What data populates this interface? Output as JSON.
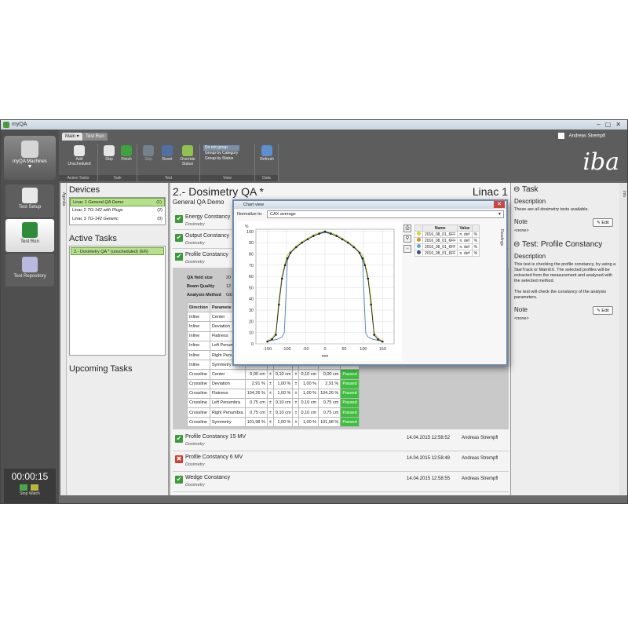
{
  "window": {
    "title": "myQA"
  },
  "user": {
    "name": "Andreas Strempfl"
  },
  "brand": {
    "logo_text": "iba"
  },
  "left_nav": {
    "machines_label": "myQA Machines",
    "items": [
      {
        "label": "Test Setup",
        "icon": "clipboard-icon",
        "active": false
      },
      {
        "label": "Test Run",
        "icon": "play-icon",
        "active": true
      },
      {
        "label": "Test Repository",
        "icon": "repository-icon",
        "active": false
      }
    ],
    "stopwatch": {
      "time": "00:00:15",
      "label": "Stop Watch"
    }
  },
  "ribbon": {
    "tabs": [
      "Main",
      "Test Run"
    ],
    "groups": [
      {
        "label": "Active Tasks",
        "buttons": [
          "Add Unscheduled"
        ]
      },
      {
        "label": "Task",
        "buttons": [
          "Skip",
          "Finish"
        ]
      },
      {
        "label": "Test",
        "buttons": [
          "Skip",
          "Reset",
          "Override Status"
        ]
      },
      {
        "label": "View",
        "options": [
          "Do not group",
          "Group by Category",
          "Group by Status"
        ]
      },
      {
        "label": "Data",
        "buttons": [
          "Refresh"
        ]
      }
    ]
  },
  "sidebar": {
    "agenda_label": "Agenda",
    "devices_title": "Devices",
    "devices": [
      {
        "name": "Linac 1",
        "desc": "General QA Demo",
        "count": "(1)",
        "selected": true
      },
      {
        "name": "Linac 2",
        "desc": "TG-142 with Plugs",
        "count": "(2)",
        "selected": false
      },
      {
        "name": "Linac 3",
        "desc": "TG-142 Generic",
        "count": "(0)",
        "selected": false
      }
    ],
    "active_tasks_title": "Active Tasks",
    "active_tasks": [
      {
        "label": "2.- Dosimetry QA *   (unscheduled)   (6/6)"
      }
    ],
    "upcoming_title": "Upcoming Tasks"
  },
  "main": {
    "title": "2.- Dosimetry QA *",
    "linac": "Linac 1",
    "subtitle": "General QA Demo",
    "tests_top": [
      {
        "name": "Energy Constancy",
        "sub": "Dosimetry"
      },
      {
        "name": "Output Constancy",
        "sub": "Dosimetry"
      }
    ],
    "profile": {
      "name": "Profile Constancy",
      "sub": "Dosimetry",
      "qa_field_size_label": "QA field size",
      "qa_field_size": "20",
      "beam_quality_label": "Beam Quality",
      "beam_quality": "12",
      "analysis_method_label": "Analysis Method",
      "analysis_method": "GE",
      "headers": [
        "Direction",
        "Paramete"
      ],
      "rows": [
        [
          "Inline",
          "Center",
          "",
          "",
          "",
          "",
          "",
          "",
          ""
        ],
        [
          "Inline",
          "Deviation",
          "",
          "",
          "",
          "",
          "",
          "",
          ""
        ],
        [
          "Inline",
          "Flatness",
          "",
          "",
          "",
          "",
          "",
          "",
          ""
        ],
        [
          "Inline",
          "Left Penumbra",
          "",
          "",
          "",
          "",
          "",
          "",
          ""
        ],
        [
          "Inline",
          "Right Penumbra",
          "",
          "",
          "",
          "",
          "",
          "",
          ""
        ],
        [
          "Inline",
          "Symmetry",
          "",
          "",
          "",
          "",
          "",
          "",
          ""
        ],
        [
          "Crossline",
          "Center",
          "0,00 cm",
          "±",
          "0,10 cm",
          "±",
          "0,10 cm",
          "0,00 cm",
          "Passed"
        ],
        [
          "Crossline",
          "Deviation",
          "2,91 %",
          "±",
          "1,00 %",
          "±",
          "1,00 %",
          "2,91 %",
          "Passed"
        ],
        [
          "Crossline",
          "Flatness",
          "104,26 %",
          "±",
          "1,00 %",
          "±",
          "1,00 %",
          "104,26 %",
          "Passed"
        ],
        [
          "Crossline",
          "Left Penumbra",
          "0,75 cm",
          "±",
          "0,10 cm",
          "±",
          "0,10 cm",
          "0,75 cm",
          "Passed"
        ],
        [
          "Crossline",
          "Right Penumbra",
          "0,75 cm",
          "±",
          "0,10 cm",
          "±",
          "0,10 cm",
          "0,75 cm",
          "Passed"
        ],
        [
          "Crossline",
          "Symmetry",
          "101,98 %",
          "±",
          "1,00 %",
          "±",
          "1,00 %",
          "101,98 %",
          "Passed"
        ]
      ]
    },
    "tests_bottom": [
      {
        "name": "Profile Constancy 15 MV",
        "sub": "Dosimetry",
        "date": "14.04.2015 12:58:52",
        "user": "Andreas Strempfl",
        "status": "passed"
      },
      {
        "name": "Profile Constancy 6 MV",
        "sub": "Dosimetry",
        "date": "14.04.2015 12:58:48",
        "user": "Andreas Strempfl",
        "status": "failed"
      },
      {
        "name": "Wedge Constancy",
        "sub": "Dosimetry",
        "date": "14.04.2015 12:58:55",
        "user": "Andreas Strempfl",
        "status": "passed"
      }
    ]
  },
  "task_panel": {
    "task_title": "Task",
    "description_label": "Description",
    "task_description": "These are all dosimetry tests available.",
    "note_label": "Note",
    "note_value": "<none>",
    "edit_label": "Edit",
    "test_title": "Test: Profile Constancy",
    "test_description": "This test is checking the profile constancy, by using a StarTrack or MatriXX. The selected profiles will be extracted from the measurement and analysed with the selected method.",
    "test_description2": "The test will check the constancy of the analysis parameters.",
    "info_label": "Info"
  },
  "chart_view": {
    "title": "Chart view",
    "normalize_label": "Normalize to:",
    "normalize_value": "CAX average",
    "tools": [
      "print",
      "zoom",
      "minus"
    ],
    "legend_headers": [
      "",
      "Name",
      "Value",
      ""
    ],
    "legend": [
      {
        "name": "2016_08_01_6FF",
        "value": "n. def",
        "unit": "%",
        "color": "#d6d23a"
      },
      {
        "name": "2016_08_01_6FF",
        "value": "n. def",
        "unit": "%",
        "color": "#e08a2a"
      },
      {
        "name": "2016_08_01_6FF",
        "value": "n. def",
        "unit": "%",
        "color": "#5aa6d6"
      },
      {
        "name": "2016_08_01_6FF",
        "value": "n. def",
        "unit": "%",
        "color": "#2f4f7a"
      }
    ],
    "readings_label": "Readings"
  },
  "chart_data": {
    "type": "line",
    "xlabel": "mm",
    "ylabel": "%",
    "xlim": [
      -180,
      180
    ],
    "ylim": [
      0,
      102
    ],
    "xticks": [
      -150,
      -100,
      -50,
      0,
      50,
      100,
      150
    ],
    "yticks": [
      0,
      10,
      20,
      30,
      40,
      50,
      60,
      70,
      80,
      90,
      100
    ],
    "grid": true,
    "series": [
      {
        "color": "#b5cc3a",
        "x": [
          -150,
          -138,
          -128,
          -120,
          -112,
          -104,
          -100,
          -90,
          -75,
          -60,
          -45,
          -30,
          -15,
          0,
          15,
          30,
          45,
          60,
          75,
          90,
          100,
          104,
          112,
          120,
          128,
          138,
          150
        ],
        "y": [
          3,
          5,
          10,
          40,
          60,
          72,
          78,
          82,
          87,
          91,
          94,
          97,
          99,
          100,
          99,
          97,
          94,
          91,
          87,
          82,
          78,
          72,
          60,
          40,
          10,
          5,
          3
        ]
      },
      {
        "color": "#4f7fb0",
        "x": [
          -150,
          -140,
          -125,
          -112,
          -106,
          -102,
          -98,
          -90,
          -75,
          -60,
          -45,
          -30,
          -15,
          0,
          15,
          30,
          45,
          60,
          75,
          90,
          98,
          102,
          106,
          112,
          125,
          140,
          150
        ],
        "y": [
          2,
          3,
          4,
          6,
          10,
          40,
          74,
          81,
          86,
          90,
          93,
          96,
          98,
          99,
          98,
          96,
          93,
          90,
          86,
          81,
          74,
          40,
          10,
          6,
          4,
          3,
          2
        ]
      },
      {
        "color": "#2a2a2a",
        "x": [
          -150,
          -138,
          -128,
          -120,
          -112,
          -104,
          -98,
          -90,
          -75,
          -60,
          -45,
          -30,
          -15,
          0,
          15,
          30,
          45,
          60,
          75,
          90,
          98,
          104,
          112,
          120,
          128,
          138,
          150
        ],
        "y": [
          2,
          4,
          8,
          35,
          58,
          70,
          76,
          81,
          86,
          90,
          93,
          96,
          98,
          100,
          98,
          96,
          93,
          90,
          86,
          81,
          76,
          70,
          58,
          35,
          8,
          4,
          2
        ]
      }
    ]
  }
}
